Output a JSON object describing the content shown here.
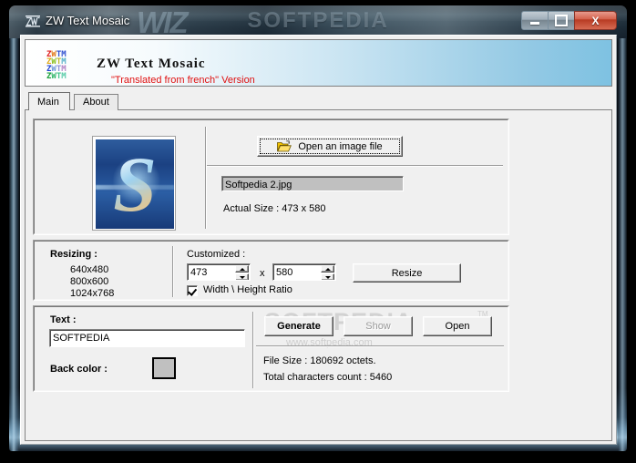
{
  "window": {
    "title": "ZW Text Mosaic",
    "icon": "zw-monogram-icon",
    "watermark": "SOFTPEDIA",
    "watermark_left": "WIZ",
    "controls": {
      "minimize": "minimize-button",
      "maximize": "maximize-button",
      "close_glyph": "X"
    }
  },
  "header": {
    "title": "ZW Text Mosaic",
    "subtitle": "\"Translated from french\" Version",
    "logo_rows": [
      {
        "text": "ZWTM",
        "colors": [
          "#e02020",
          "#e09010",
          "#3050d0",
          "#3050d0"
        ]
      },
      {
        "text": "ZWTM",
        "colors": [
          "#e0a010",
          "#80c020",
          "#b0b030",
          "#50b0c0"
        ]
      },
      {
        "text": "ZWTM",
        "colors": [
          "#2040d0",
          "#6090d0",
          "#9090d0",
          "#b080c0"
        ]
      },
      {
        "text": "ZWTM",
        "colors": [
          "#20a040",
          "#30b060",
          "#40c080",
          "#50c8a0"
        ]
      }
    ]
  },
  "tabs": [
    {
      "label": "Main",
      "selected": true
    },
    {
      "label": "About",
      "selected": false
    }
  ],
  "image_panel": {
    "open_button": "Open an image file",
    "open_button_icon": "open-folder-icon",
    "file_name": "Softpedia 2.jpg",
    "actual_size": "Actual Size : 473 x 580",
    "preview_letter": "S"
  },
  "resizing_panel": {
    "title": "Resizing :",
    "presets": [
      "640x480",
      "800x600",
      "1024x768"
    ],
    "customized_label": "Customized :",
    "width_value": "473",
    "separator": "x",
    "height_value": "580",
    "ratio_label": "Width \\ Height Ratio",
    "ratio_checked": true,
    "resize_button": "Resize"
  },
  "text_panel": {
    "text_label": "Text :",
    "text_value": "SOFTPEDIA",
    "back_color_label": "Back color :",
    "back_color_value": "#c0c0c0"
  },
  "actions_panel": {
    "generate_button": "Generate",
    "show_button": "Show",
    "show_button_disabled": true,
    "open_button": "Open",
    "file_size": "File Size : 180692 octets.",
    "char_count": "Total characters count : 5460",
    "watermark_main": "SOFTPEDIA",
    "watermark_tm": "TM",
    "watermark_sub": "www.softpedia.com"
  }
}
